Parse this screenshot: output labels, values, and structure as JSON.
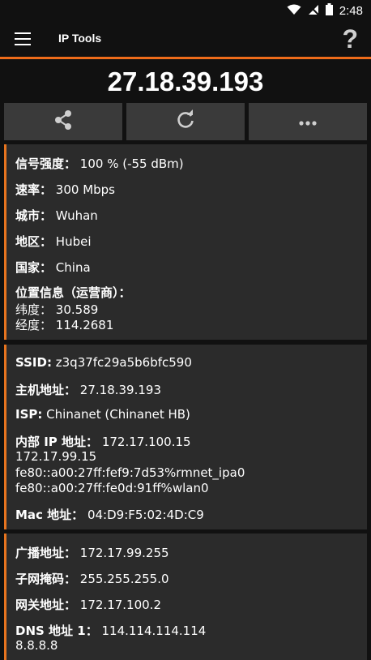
{
  "status_bar": {
    "time": "2:48",
    "icons": [
      "wifi-icon",
      "signal-icon",
      "battery-icon"
    ]
  },
  "app_bar": {
    "title": "IP Tools",
    "menu_icon": "hamburger-icon",
    "help_label": "?"
  },
  "ip_address": "27.18.39.193",
  "actions": [
    {
      "name": "share",
      "icon": "share-icon"
    },
    {
      "name": "refresh",
      "icon": "refresh-icon"
    },
    {
      "name": "more",
      "icon": "more-icon"
    }
  ],
  "card1": {
    "signal_label": "信号强度：",
    "signal_value": "100 % (-55 dBm)",
    "speed_label": "速率：",
    "speed_value": "300 Mbps",
    "city_label": "城市：",
    "city_value": "Wuhan",
    "region_label": "地区：",
    "region_value": "Hubei",
    "country_label": "国家：",
    "country_value": "China",
    "location_label": "位置信息（运营商）：",
    "lat_label": "纬度：",
    "lat_value": "30.589",
    "lon_label": "经度：",
    "lon_value": "114.2681"
  },
  "card2": {
    "ssid_label": "SSID:",
    "ssid_value": "z3q37fc29a5b6bfc590",
    "host_label": "主机地址：",
    "host_value": "27.18.39.193",
    "isp_label": "ISP:",
    "isp_value": "Chinanet (Chinanet HB)",
    "internal_label": "内部 IP 地址：",
    "internal_value": "172.17.100.15",
    "internal_extra": [
      "172.17.99.15",
      "fe80::a00:27ff:fef9:7d53%rmnet_ipa0",
      "fe80::a00:27ff:fe0d:91ff%wlan0"
    ],
    "mac_label": "Mac 地址：",
    "mac_value": "04:D9:F5:02:4D:C9"
  },
  "card3": {
    "broadcast_label": "广播地址：",
    "broadcast_value": "172.17.99.255",
    "mask_label": "子网掩码：",
    "mask_value": "255.255.255.0",
    "gateway_label": "网关地址：",
    "gateway_value": "172.17.100.2",
    "dns_label": "DNS 地址 1：",
    "dns_value": "114.114.114.114",
    "dns_extra": "8.8.8.8"
  },
  "colors": {
    "accent": "#e7741f",
    "card": "#2b2b2b",
    "button": "#3a3a3a",
    "background": "#111111"
  }
}
